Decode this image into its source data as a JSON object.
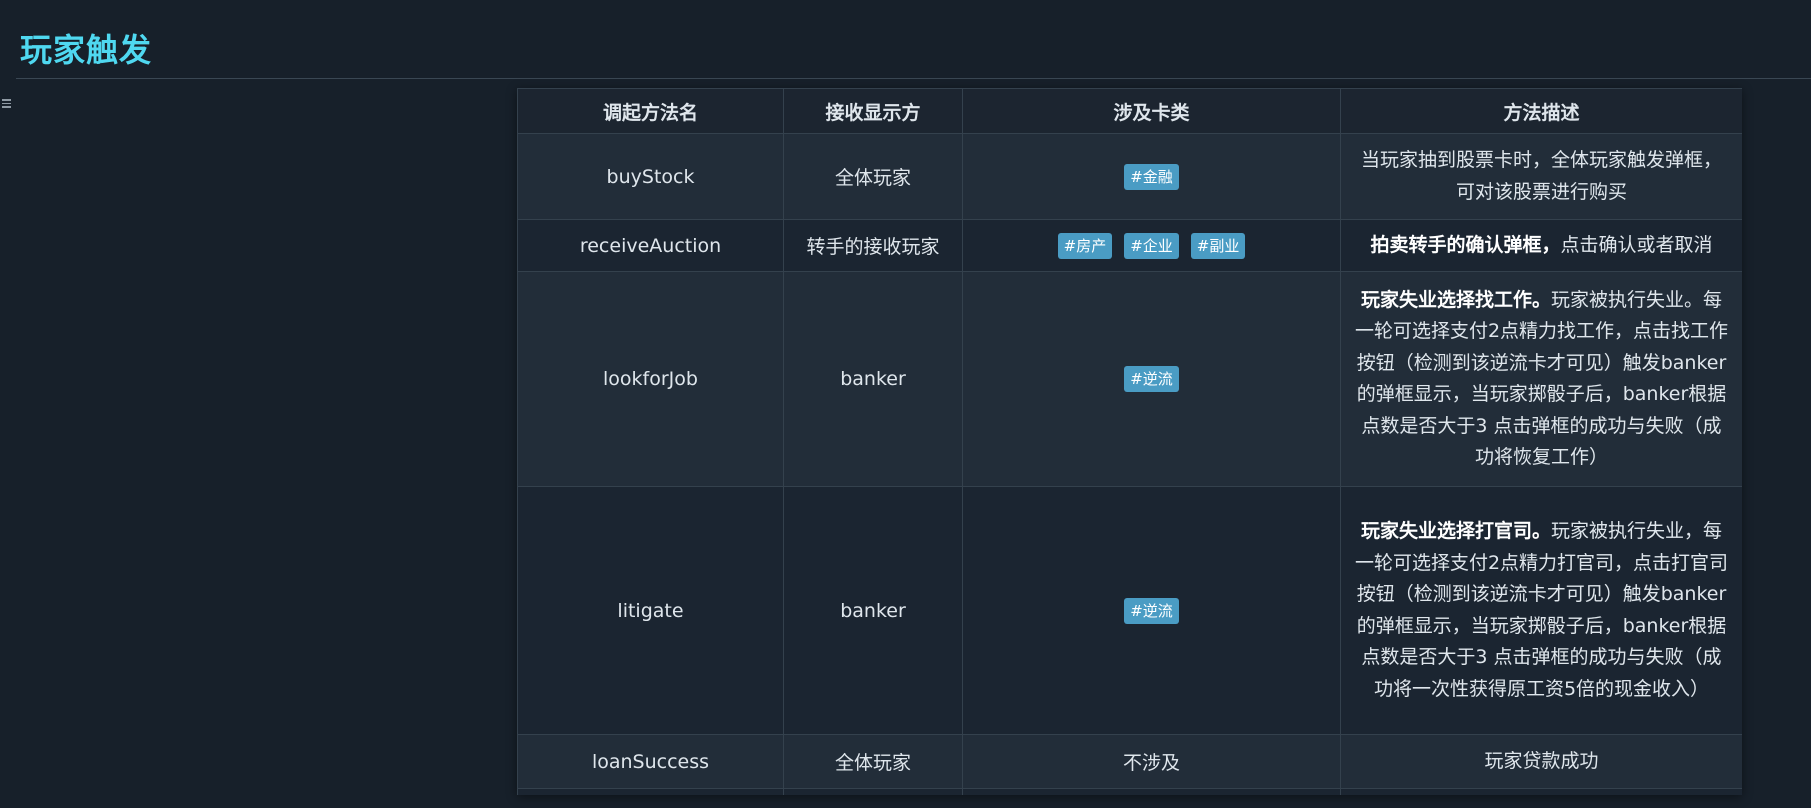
{
  "page": {
    "title": "玩家触发",
    "outline_icon": "outline-list-icon"
  },
  "table": {
    "headers": [
      "调起方法名",
      "接收显示方",
      "涉及卡类",
      "方法描述"
    ],
    "rows": [
      {
        "method": "buyStock",
        "receiver": "全体玩家",
        "tags": [
          "#金融"
        ],
        "desc_bold": "",
        "desc": "当玩家抽到股票卡时，全体玩家触发弹框，可对该股票进行购买"
      },
      {
        "method": "receiveAuction",
        "receiver": "转手的接收玩家",
        "tags": [
          "#房产",
          "#企业",
          "#副业"
        ],
        "desc_bold": "拍卖转手的确认弹框，",
        "desc": "点击确认或者取消"
      },
      {
        "method": "lookforJob",
        "receiver": "banker",
        "tags": [
          "#逆流"
        ],
        "desc_bold": "玩家失业选择找工作。",
        "desc": "玩家被执行失业。每一轮可选择支付2点精力找工作，点击找工作按钮（检测到该逆流卡才可见）触发banker的弹框显示，当玩家掷骰子后，banker根据点数是否大于3 点击弹框的成功与失败（成功将恢复工作）"
      },
      {
        "method": "litigate",
        "receiver": "banker",
        "tags": [
          "#逆流"
        ],
        "desc_bold": "玩家失业选择打官司。",
        "desc": "玩家被执行失业，每一轮可选择支付2点精力打官司，点击打官司按钮（检测到该逆流卡才可见）触发banker的弹框显示，当玩家掷骰子后，banker根据点数是否大于3 点击弹框的成功与失败（成功将一次性获得原工资5倍的现金收入）"
      },
      {
        "method": "loanSuccess",
        "receiver": "全体玩家",
        "cards_text": "不涉及",
        "tags": [],
        "desc_bold": "",
        "desc": "玩家贷款成功"
      }
    ]
  },
  "colors": {
    "background": "#17202a",
    "title": "#4fd8f0",
    "tag": "#4a9cc4",
    "border": "#34414d"
  }
}
